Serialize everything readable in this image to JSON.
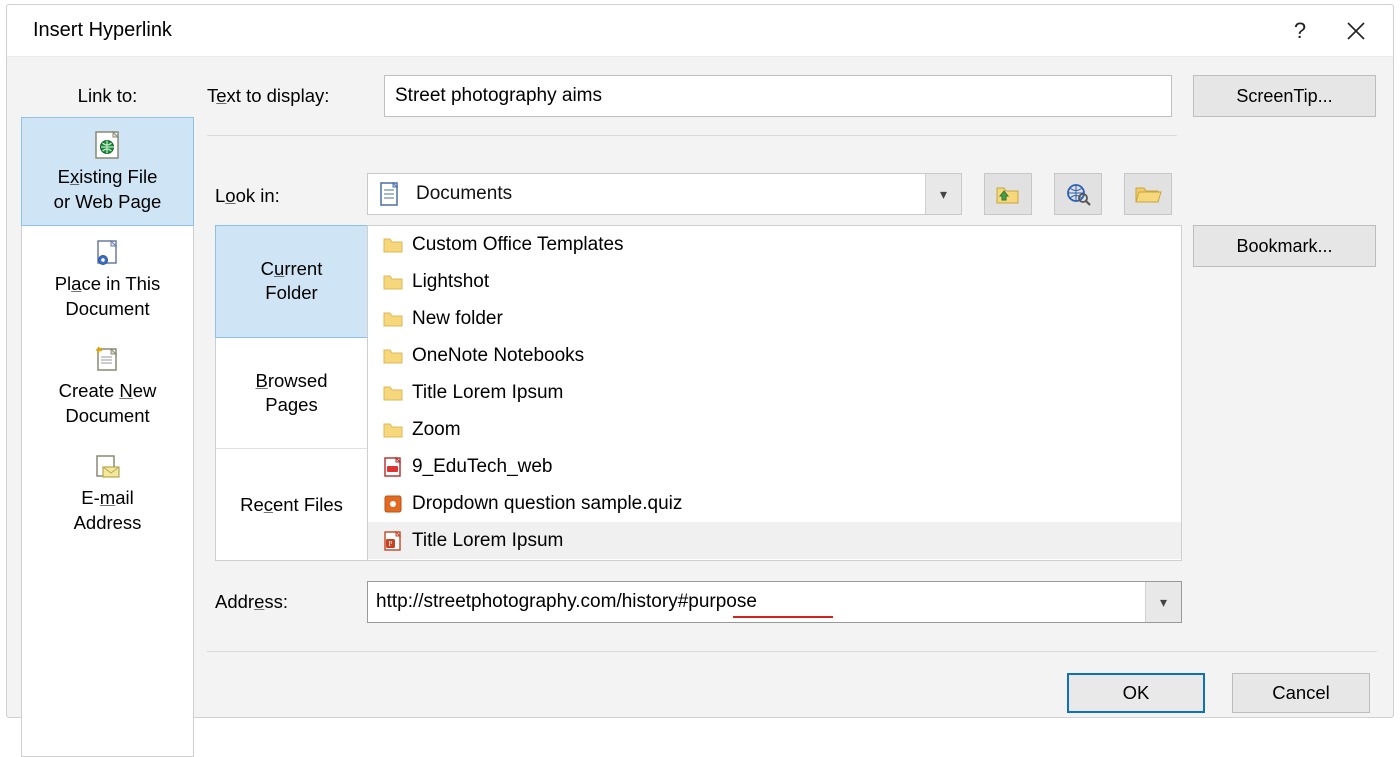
{
  "dialog": {
    "title": "Insert Hyperlink",
    "help_tooltip": "?",
    "close_tooltip": "×"
  },
  "linkto": {
    "label": "Link to:",
    "items": [
      {
        "label_line1": "Existing File",
        "label_line2": "or Web Page",
        "hotkey": "x",
        "selected": true
      },
      {
        "label_line1": "Place in This",
        "label_line2": "Document",
        "hotkey": "a",
        "selected": false
      },
      {
        "label_line1": "Create New",
        "label_line2": "Document",
        "hotkey": "N",
        "selected": false
      },
      {
        "label_line1": "E-mail",
        "label_line2": "Address",
        "hotkey": "m",
        "selected": false
      }
    ]
  },
  "text_to_display": {
    "label_before": "T",
    "label_hotkey": "e",
    "label_after": "xt to display:",
    "value": "Street photography aims"
  },
  "screentip_button": "ScreenTip...",
  "bookmark_button": "Bookmark...",
  "lookin": {
    "label_before": "L",
    "label_hotkey": "o",
    "label_after": "ok in:",
    "value": "Documents"
  },
  "browse_tabs": [
    {
      "line1_pre": "C",
      "line1_hot": "u",
      "line1_post": "rrent",
      "line2": "Folder",
      "selected": true
    },
    {
      "line1_pre": "",
      "line1_hot": "B",
      "line1_post": "rowsed",
      "line2": "Pages",
      "selected": false
    },
    {
      "line1_pre": "Re",
      "line1_hot": "c",
      "line1_post": "ent Files",
      "line2": "",
      "selected": false
    }
  ],
  "file_list": [
    {
      "name": "Custom Office Templates",
      "type": "folder",
      "selected": false
    },
    {
      "name": "Lightshot",
      "type": "folder",
      "selected": false
    },
    {
      "name": "New folder",
      "type": "folder",
      "selected": false
    },
    {
      "name": "OneNote Notebooks",
      "type": "folder",
      "selected": false
    },
    {
      "name": "Title Lorem Ipsum",
      "type": "folder",
      "selected": false
    },
    {
      "name": "Zoom",
      "type": "folder",
      "selected": false
    },
    {
      "name": "9_EduTech_web",
      "type": "pdf",
      "selected": false
    },
    {
      "name": "Dropdown question sample.quiz",
      "type": "quiz",
      "selected": false
    },
    {
      "name": "Title Lorem Ipsum",
      "type": "pptx",
      "selected": true
    }
  ],
  "address": {
    "label_before": "Addr",
    "label_hotkey": "e",
    "label_after": "ss:",
    "value": "http://streetphotography.com/history#purpose"
  },
  "buttons": {
    "ok": "OK",
    "cancel": "Cancel"
  }
}
